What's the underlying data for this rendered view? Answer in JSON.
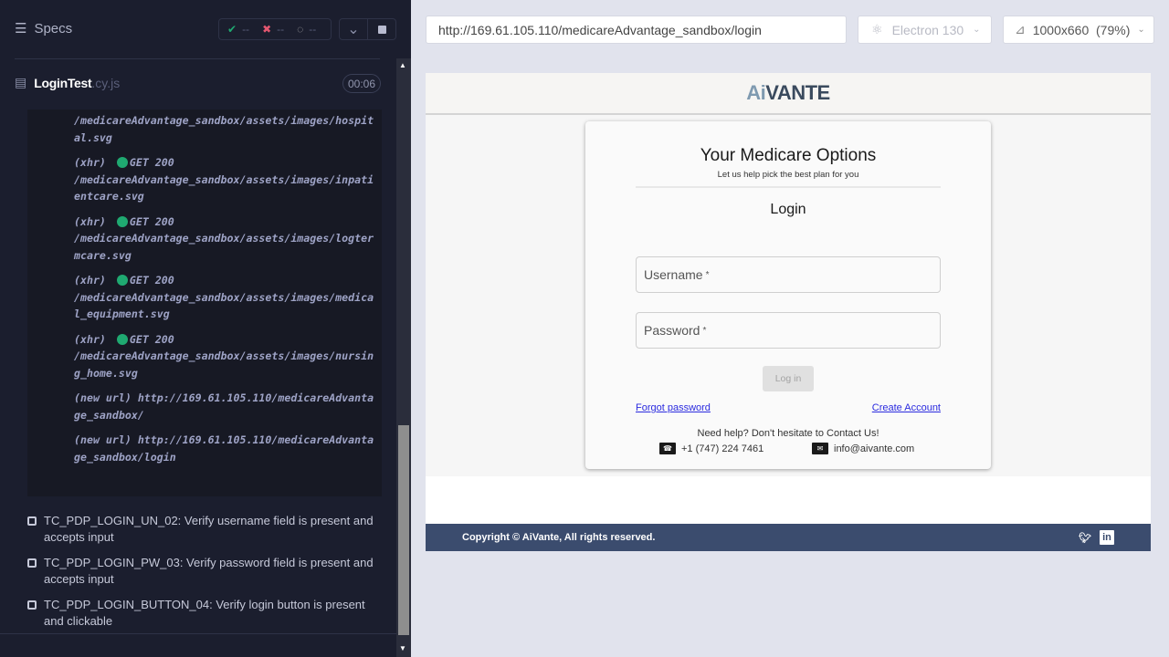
{
  "sidebar": {
    "title": "Specs",
    "stats": {
      "passed": "--",
      "failed": "--",
      "pending": "--"
    },
    "spec": {
      "name": "LoginTest",
      "ext": ".cy.js",
      "time": "00:06"
    },
    "log": [
      {
        "prefix": "",
        "method": "",
        "path": "/medicareAdvantage_sandbox/assets/images/hospital.svg"
      },
      {
        "prefix": "(xhr)",
        "method": "GET 200",
        "path": "/medicareAdvantage_sandbox/assets/images/inpatientcare.svg"
      },
      {
        "prefix": "(xhr)",
        "method": "GET 200",
        "path": "/medicareAdvantage_sandbox/assets/images/logtermcare.svg"
      },
      {
        "prefix": "(xhr)",
        "method": "GET 200",
        "path": "/medicareAdvantage_sandbox/assets/images/medical_equipment.svg"
      },
      {
        "prefix": "(xhr)",
        "method": "GET 200",
        "path": "/medicareAdvantage_sandbox/assets/images/nursing_home.svg"
      },
      {
        "prefix": "(new url)",
        "url": "http://169.61.105.110/medicareAdvantage_sandbox/"
      },
      {
        "prefix": "(new url)",
        "url": "http://169.61.105.110/medicareAdvantage_sandbox/login"
      }
    ],
    "tests": [
      "TC_PDP_LOGIN_UN_02: Verify username field is present and accepts input",
      "TC_PDP_LOGIN_PW_03: Verify password field is present and accepts input",
      "TC_PDP_LOGIN_BUTTON_04: Verify login button is present and clickable"
    ]
  },
  "toolbar": {
    "url": "http://169.61.105.110/medicareAdvantage_sandbox/login",
    "browser": "Electron 130",
    "viewport": "1000x660  (79%)"
  },
  "app": {
    "logo": "AiVANTE",
    "title": "Your Medicare Options",
    "subtitle": "Let us help pick the best plan for you",
    "login_heading": "Login",
    "username_label": "Username",
    "password_label": "Password",
    "required": "*",
    "login_button": "Log in",
    "forgot": "Forgot password",
    "create": "Create Account",
    "help": "Need help? Don't hesitate to Contact Us!",
    "phone": "+1 (747) 224 7461",
    "email": "info@aivante.com",
    "copyright": "Copyright © AiVante, All rights reserved."
  },
  "colors": {
    "accent": "#1fa971",
    "footer": "#3b4c6e",
    "link": "#2a2adf"
  }
}
